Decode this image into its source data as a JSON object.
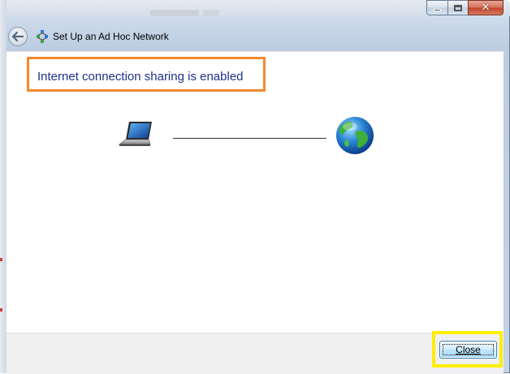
{
  "window": {
    "title": "Set Up an Ad Hoc Network",
    "caption_buttons": {
      "minimize_icon": "minimize-icon",
      "maximize_icon": "maximize-icon",
      "close_glyph": "✕"
    },
    "back_icon": "back-arrow-icon",
    "title_icon": "ad-hoc-network-icon"
  },
  "main": {
    "heading": "Internet connection sharing is enabled",
    "diagram": {
      "left_icon": "laptop-icon",
      "right_icon": "internet-globe-icon"
    }
  },
  "footer": {
    "close_label": "Close"
  },
  "colors": {
    "heading_text": "#1e3287",
    "heading_highlight": "#f28a30",
    "close_highlight": "#ffee00"
  }
}
